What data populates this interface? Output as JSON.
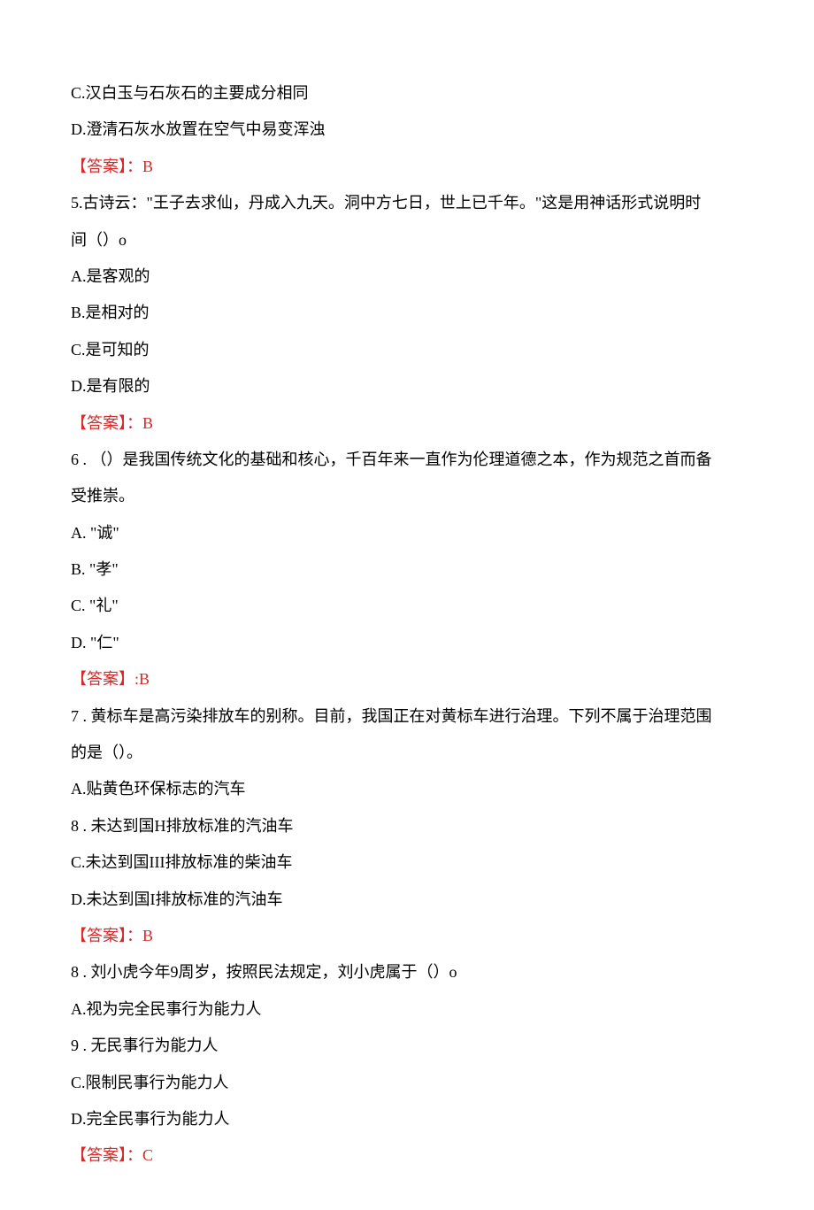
{
  "lines": {
    "q4_c": "C.汉白玉与石灰石的主要成分相同",
    "q4_d": "D.澄清石灰水放置在空气中易变浑浊",
    "q4_answer": "【答案】：B",
    "q5_stem1": "5.古诗云：\"王子去求仙，丹成入九天。洞中方七日，世上已千年。\"这是用神话形式说明时",
    "q5_stem2": "间（）o",
    "q5_a": "A.是客观的",
    "q5_b": "B.是相对的",
    "q5_c": "C.是可知的",
    "q5_d": "D.是有限的",
    "q5_answer": "【答案】：B",
    "q6_stem1": "6 . （）是我国传统文化的基础和核心，千百年来一直作为伦理道德之本，作为规范之首而备",
    "q6_stem2": "受推崇。",
    "q6_a": "A.  \"诚\"",
    "q6_b": "B.  \"孝\"",
    "q6_c": "C.  \"礼\"",
    "q6_d": "D.  \"仁\"",
    "q6_answer": "【答案】:B",
    "q7_stem1": "7 . 黄标车是高污染排放车的别称。目前，我国正在对黄标车进行治理。下列不属于治理范围",
    "q7_stem2": "的是（）。",
    "q7_a": "A.贴黄色环保标志的汽车",
    "q7_b": "8 . 未达到国H排放标准的汽油车",
    "q7_c": "C.未达到国III排放标准的柴油车",
    "q7_d": "D.未达到国I排放标准的汽油车",
    "q7_answer": "【答案】：B",
    "q8_stem": "8 . 刘小虎今年9周岁，按照民法规定，刘小虎属于（）o",
    "q8_a": "A.视为完全民事行为能力人",
    "q8_b": "9 . 无民事行为能力人",
    "q8_c": "C.限制民事行为能力人",
    "q8_d": "D.完全民事行为能力人",
    "q8_answer": "【答案】：C"
  }
}
